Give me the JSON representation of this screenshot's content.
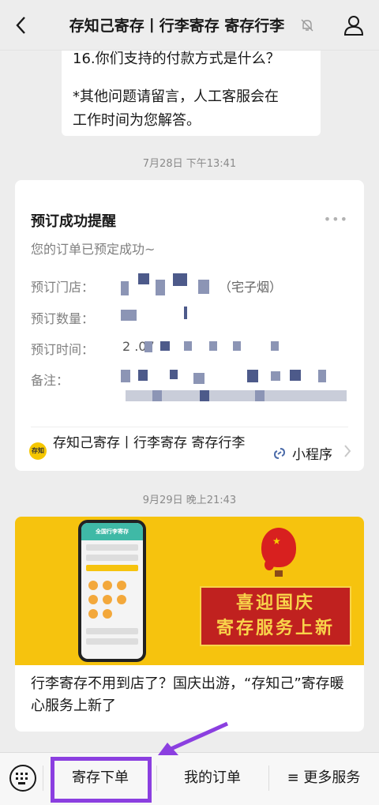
{
  "header": {
    "title": "存知己寄存丨行李寄存 寄存行李",
    "back_icon": "chevron-left-icon",
    "mute_icon": "bell-off-icon",
    "profile_icon": "user-icon"
  },
  "top_bubble": {
    "line1": "16.你们支持的付款方式是什么？",
    "line2": "*其他问题请留言，人工客服会在",
    "line3": "工作时间为您解答。"
  },
  "timestamp_1": "7月28日 下午13:41",
  "order_card": {
    "title": "预订成功提醒",
    "subtitle": "您的订单已预定成功~",
    "fields": [
      {
        "label": "预订门店：",
        "value": "（宅子烟）"
      },
      {
        "label": "预订数量：",
        "value": ""
      },
      {
        "label": "预订时间：",
        "value": "2                   .07"
      },
      {
        "label": "备注：",
        "value": ""
      }
    ],
    "mini_program_logo_text": "存知己",
    "mini_program_name": "存知己寄存丨行李寄存 寄存行李",
    "mini_program_tag": "小程序"
  },
  "timestamp_2": "9月29日 晚上21:43",
  "article_card": {
    "phone_header": "全国行李寄存",
    "banner_line1": "喜迎国庆",
    "banner_line2": "寄存服务上新",
    "title": "行李寄存不用到店了？国庆出游，“存知己”寄存暖心服务上新了"
  },
  "bottom_menu": {
    "keyboard_icon": "keyboard-icon",
    "items": [
      "寄存下单",
      "我的订单",
      "≡ 更多服务"
    ]
  },
  "colors": {
    "highlight": "#8b3fe0",
    "banner": "#f6c30e"
  }
}
